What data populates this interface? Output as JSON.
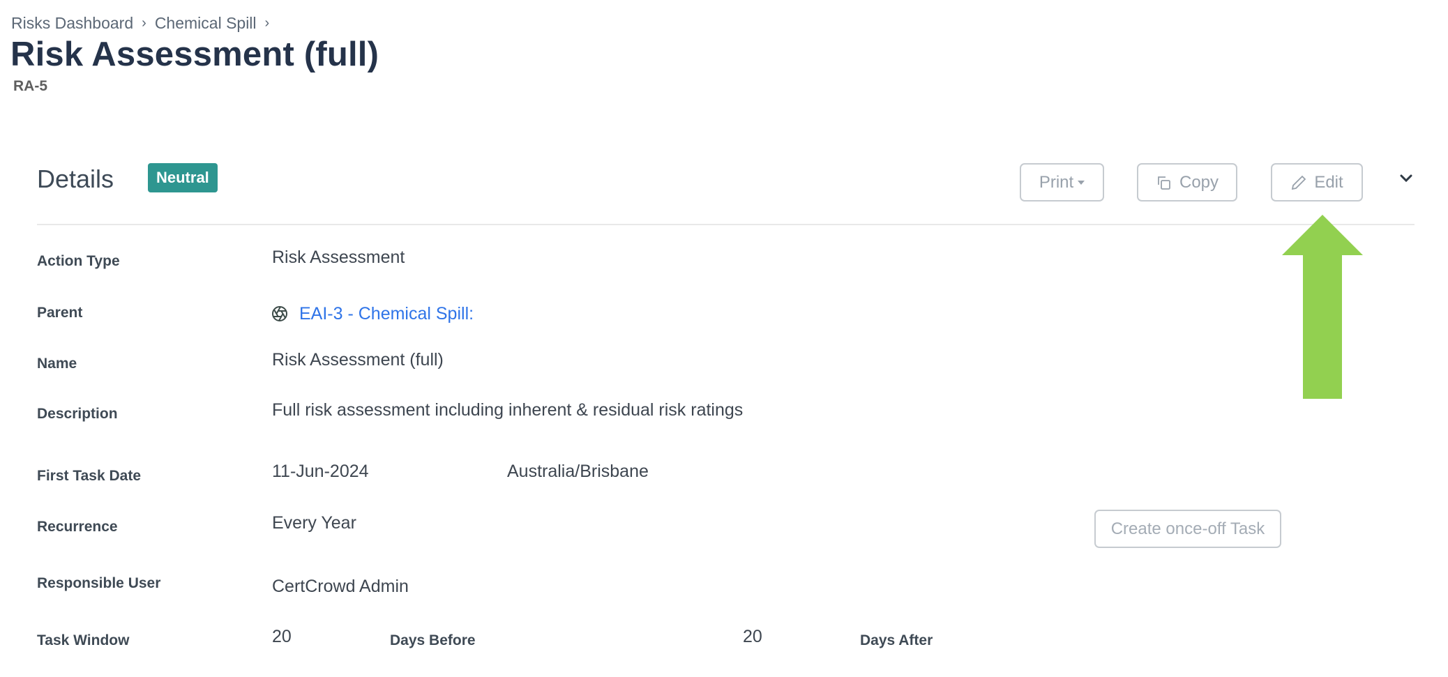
{
  "breadcrumb": [
    {
      "label": "Risks Dashboard"
    },
    {
      "label": "Chemical Spill"
    }
  ],
  "breadcrumb_separator": "›",
  "page": {
    "title": "Risk Assessment (full)",
    "code": "RA-5"
  },
  "details": {
    "heading": "Details",
    "status_badge": "Neutral",
    "status_color": "#2e9690",
    "toolbar": {
      "print_label": "Print",
      "copy_label": "Copy",
      "edit_label": "Edit"
    },
    "fields": {
      "action_type": {
        "label": "Action Type",
        "value": "Risk Assessment"
      },
      "parent": {
        "label": "Parent",
        "value": "EAI-3 - Chemical Spill:",
        "icon": "aperture-icon"
      },
      "name": {
        "label": "Name",
        "value": "Risk Assessment (full)"
      },
      "description": {
        "label": "Description",
        "value": "Full risk assessment including inherent & residual risk ratings"
      },
      "first_task_date": {
        "label": "First Task Date",
        "value": "11-Jun-2024",
        "timezone": "Australia/Brisbane"
      },
      "recurrence": {
        "label": "Recurrence",
        "value": "Every Year"
      },
      "responsible_user": {
        "label": "Responsible User",
        "value": "CertCrowd Admin"
      },
      "task_window": {
        "label": "Task Window",
        "days_before": "20",
        "days_before_label": "Days Before",
        "days_after": "20",
        "days_after_label": "Days After"
      }
    },
    "create_once_off_label": "Create once-off Task"
  },
  "annotation": {
    "type": "arrow-up",
    "color": "#92d050",
    "points_to": "Edit"
  }
}
